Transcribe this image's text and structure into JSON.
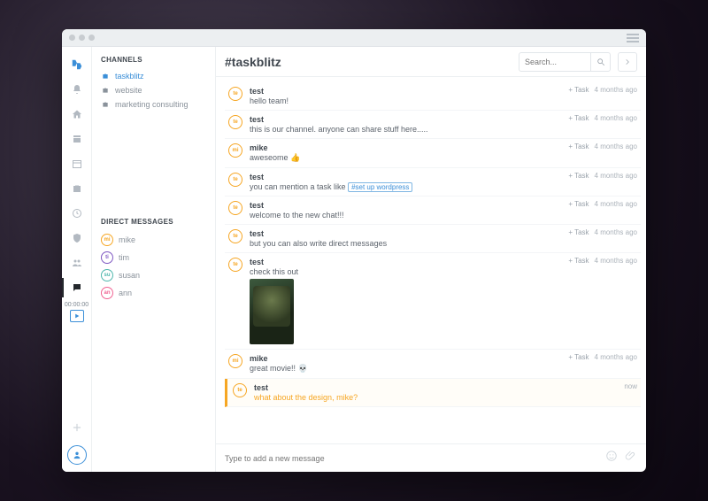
{
  "sidebar": {
    "channels_title": "CHANNELS",
    "channels": [
      {
        "label": "taskblitz",
        "active": true
      },
      {
        "label": "website",
        "active": false
      },
      {
        "label": "marketing consulting",
        "active": false
      }
    ],
    "dm_title": "DIRECT MESSAGES",
    "dms": [
      {
        "label": "mike",
        "initials": "mi",
        "color": "#f6a623"
      },
      {
        "label": "tim",
        "initials": "ti",
        "color": "#7e57c2"
      },
      {
        "label": "susan",
        "initials": "su",
        "color": "#4db6ac"
      },
      {
        "label": "ann",
        "initials": "an",
        "color": "#f06292"
      }
    ],
    "timer": "00:00:00"
  },
  "header": {
    "title": "#taskblitz",
    "search_placeholder": "Search..."
  },
  "labels": {
    "add_task": "+ Task",
    "time_default": "4 months ago",
    "time_now": "now"
  },
  "composer": {
    "placeholder": "Type to add a new message"
  },
  "messages": [
    {
      "user": "test",
      "initials": "te",
      "color": "#f6a623",
      "text": "hello team!",
      "time": "4 months ago"
    },
    {
      "user": "test",
      "initials": "te",
      "color": "#f6a623",
      "text": "this is our channel. anyone can share stuff here.....",
      "time": "4 months ago"
    },
    {
      "user": "mike",
      "initials": "mi",
      "color": "#f6a623",
      "text": "aweseome 👍",
      "time": "4 months ago"
    },
    {
      "user": "test",
      "initials": "te",
      "color": "#f6a623",
      "text": "you can mention a task like ",
      "tag": "#set up wordpress",
      "time": "4 months ago"
    },
    {
      "user": "test",
      "initials": "te",
      "color": "#f6a623",
      "text": "welcome to the new chat!!!",
      "time": "4 months ago"
    },
    {
      "user": "test",
      "initials": "te",
      "color": "#f6a623",
      "text": "but you can also write direct messages",
      "time": "4 months ago"
    },
    {
      "user": "test",
      "initials": "te",
      "color": "#f6a623",
      "text": "check this out",
      "time": "4 months ago",
      "image": true
    },
    {
      "user": "mike",
      "initials": "mi",
      "color": "#f6a623",
      "text": "great movie!! 💀",
      "time": "4 months ago"
    },
    {
      "user": "test",
      "initials": "te",
      "color": "#f6a623",
      "text": "what about the design, mike?",
      "time": "now",
      "highlighted": true,
      "no_task": true
    }
  ]
}
